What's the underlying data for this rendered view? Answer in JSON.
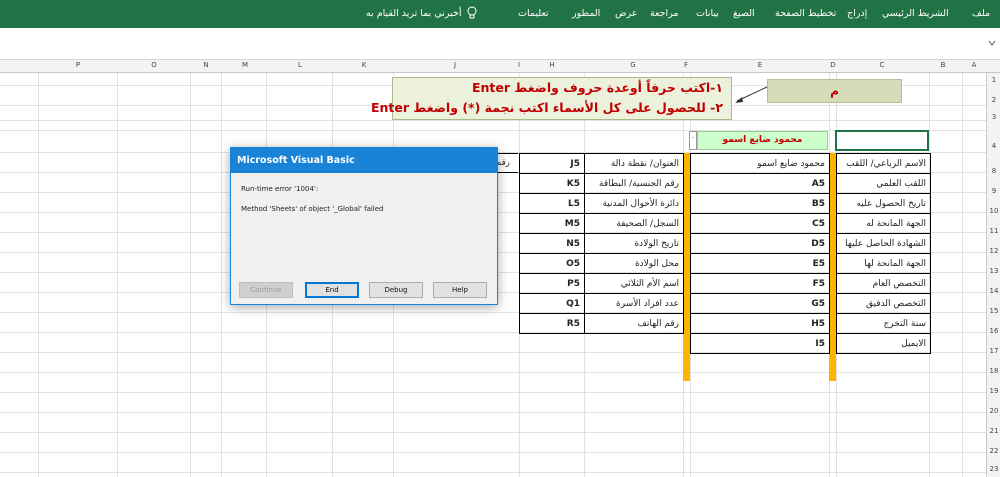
{
  "ribbon": {
    "tabs": [
      "ملف",
      "الشريط الرئيسي",
      "إدراج",
      "تخطيط الصفحة",
      "الصيغ",
      "بيانات",
      "مراجعة",
      "عرض",
      "المطور",
      "تعليمات"
    ],
    "tell_me": "أخبرني بما تريد القيام به",
    "color": "#217346"
  },
  "columns": [
    "A",
    "B",
    "C",
    "D",
    "E",
    "F",
    "G",
    "H",
    "I",
    "J",
    "K",
    "L",
    "M",
    "N",
    "O",
    "P"
  ],
  "rows": [
    "1",
    "2",
    "3",
    "4",
    "8",
    "9",
    "10",
    "11",
    "12",
    "13",
    "14",
    "15",
    "16",
    "17",
    "18",
    "19",
    "20",
    "21",
    "22",
    "23"
  ],
  "callout": {
    "line1": "١-اكتب حرفاً أوعدة حروف واضغط Enter",
    "line2": "٢- للحصول على كل الأسماء اكتب نجمة (*) واضغط Enter"
  },
  "m_box": "م",
  "green_name": "محمود ضايع اسمو",
  "green_small": ".",
  "table_right": [
    {
      "label": "الاسم الرباعي/ اللقب",
      "value": "محمود ضايع اسمو"
    },
    {
      "label": "اللقب العلمي",
      "value": "A5"
    },
    {
      "label": "تاريخ الحصول عليه",
      "value": "B5"
    },
    {
      "label": "الجهة المانحة له",
      "value": "C5"
    },
    {
      "label": "الشهادة الحاصل عليها",
      "value": "D5"
    },
    {
      "label": "الجهة المانحة لها",
      "value": "E5"
    },
    {
      "label": "التخصص العام",
      "value": "F5"
    },
    {
      "label": "التخصص الدقيق",
      "value": "G5"
    },
    {
      "label": "سنة التخرج",
      "value": "H5"
    },
    {
      "label": "الايميل",
      "value": "I5"
    }
  ],
  "table_left": [
    {
      "label": "العنوان/ نقطة دالة",
      "value": "J5"
    },
    {
      "label": "رقم الجنسية/ البطاقة",
      "value": "K5"
    },
    {
      "label": "دائرة الأحوال المدنية",
      "value": "L5"
    },
    {
      "label": "السجل/ الصحيفة",
      "value": "M5"
    },
    {
      "label": "تاريخ الولادة",
      "value": "N5"
    },
    {
      "label": "محل الولادة",
      "value": "O5"
    },
    {
      "label": "اسم الأم الثلاثي",
      "value": "P5"
    },
    {
      "label": "عدد افراد الأسرة",
      "value": "Q1"
    },
    {
      "label": "رقم الهاتف",
      "value": "R5"
    }
  ],
  "partial_cell": "رقم",
  "dialog": {
    "title": "Microsoft Visual Basic",
    "error": "Run-time error '1004':",
    "message": "Method 'Sheets' of object '_Global' failed",
    "buttons": {
      "continue": "Continue",
      "end": "End",
      "debug": "Debug",
      "help": "Help"
    }
  },
  "accent_orange": "#ffb400",
  "dialog_blue": "#1883d7"
}
